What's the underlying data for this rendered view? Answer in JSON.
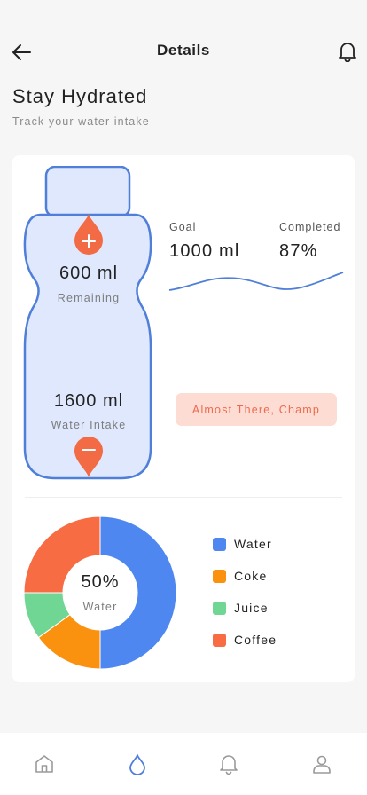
{
  "header": {
    "title": "Details"
  },
  "intro": {
    "heading": "Stay Hydrated",
    "subheading": "Track your water intake"
  },
  "bottle": {
    "remaining_value": "600 ml",
    "remaining_label": "Remaining",
    "intake_value": "1600 ml",
    "intake_label": "Water Intake",
    "fill_color": "#dfe8fc",
    "outline_color": "#4f7fd9",
    "button_color": "#f26b45"
  },
  "stats": {
    "goal_label": "Goal",
    "goal_value": "1000 ml",
    "completed_label": "Completed",
    "completed_value": "87%",
    "wave_color": "#4f7fd9"
  },
  "cta": {
    "label": "Almost There, Champ"
  },
  "donut": {
    "center_value": "50%",
    "center_label": "Water"
  },
  "chart_data": {
    "type": "pie",
    "categories": [
      "Water",
      "Coke",
      "Juice",
      "Coffee"
    ],
    "values": [
      50,
      15,
      10,
      25
    ],
    "colors": [
      "#4f87f0",
      "#fa9210",
      "#6fd694",
      "#f86c44"
    ],
    "legend": "right"
  },
  "legend": [
    {
      "label": "Water",
      "color": "#4f87f0"
    },
    {
      "label": "Coke",
      "color": "#fa9210"
    },
    {
      "label": "Juice",
      "color": "#6fd694"
    },
    {
      "label": "Coffee",
      "color": "#f86c44"
    }
  ],
  "tabs": [
    {
      "icon": "home-icon",
      "active": false
    },
    {
      "icon": "water-drop-icon",
      "active": true
    },
    {
      "icon": "bell-icon",
      "active": false
    },
    {
      "icon": "user-icon",
      "active": false
    }
  ],
  "colors": {
    "accent": "#4f7fd9",
    "inactive_icon": "#9a9a9a"
  }
}
